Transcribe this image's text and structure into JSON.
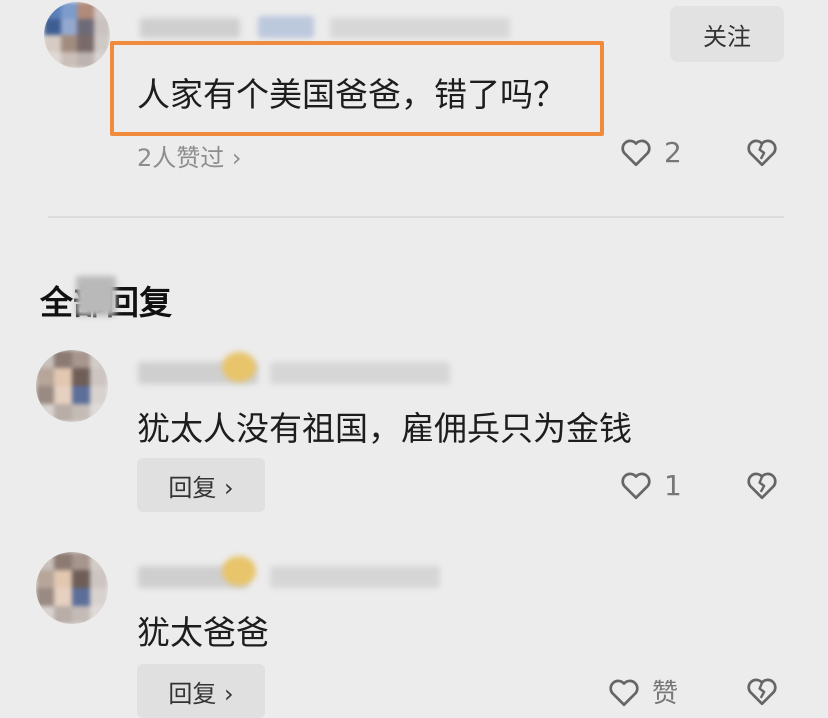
{
  "main_comment": {
    "follow_label": "关注",
    "text": "人家有个美国爸爸，错了吗？",
    "likes_summary": "2人赞过 ›",
    "like_count": "2"
  },
  "section": {
    "title": "全部回复"
  },
  "replies": [
    {
      "text": "犹太人没有祖国，雇佣兵只为金钱",
      "reply_label": "回复 ›",
      "like_count": "1"
    },
    {
      "text": "犹太爸爸",
      "reply_label": "回复 ›",
      "like_label": "赞"
    }
  ],
  "colors": {
    "highlight": "#f08a3c",
    "background": "#ececec"
  },
  "icons": [
    "heart-outline-icon",
    "broken-heart-icon",
    "chevron-right-icon"
  ]
}
